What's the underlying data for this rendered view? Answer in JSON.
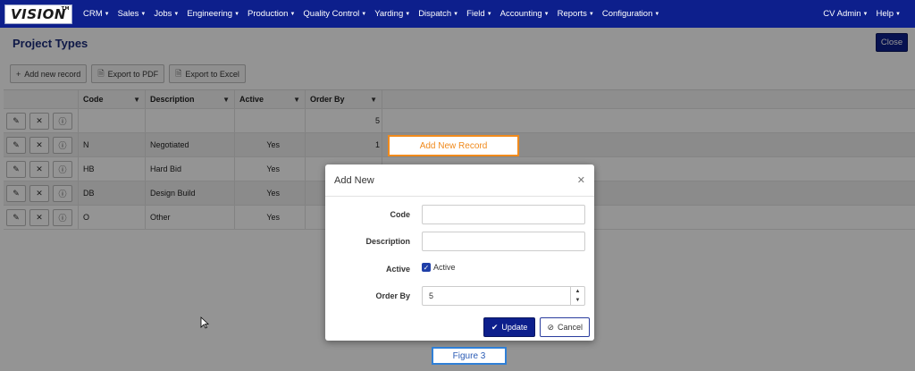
{
  "nav": {
    "logo": "VISION",
    "logo_tm": "TM",
    "menu": [
      {
        "label": "CRM"
      },
      {
        "label": "Sales"
      },
      {
        "label": "Jobs"
      },
      {
        "label": "Engineering"
      },
      {
        "label": "Production"
      },
      {
        "label": "Quality Control"
      },
      {
        "label": "Yarding"
      },
      {
        "label": "Dispatch"
      },
      {
        "label": "Field"
      },
      {
        "label": "Accounting"
      },
      {
        "label": "Reports"
      },
      {
        "label": "Configuration"
      }
    ],
    "user": "CV Admin",
    "help": "Help"
  },
  "page": {
    "title": "Project Types",
    "close_label": "Close",
    "toolbar": {
      "add": "Add new record",
      "pdf": "Export to PDF",
      "excel": "Export to Excel"
    }
  },
  "grid": {
    "columns": {
      "code": "Code",
      "description": "Description",
      "active": "Active",
      "order_by": "Order By"
    },
    "rows": [
      {
        "code": "",
        "description": "",
        "active": "",
        "order_by": "5"
      },
      {
        "code": "N",
        "description": "Negotiated",
        "active": "Yes",
        "order_by": "1"
      },
      {
        "code": "HB",
        "description": "Hard Bid",
        "active": "Yes",
        "order_by": ""
      },
      {
        "code": "DB",
        "description": "Design Build",
        "active": "Yes",
        "order_by": ""
      },
      {
        "code": "O",
        "description": "Other",
        "active": "Yes",
        "order_by": ""
      }
    ]
  },
  "annotations": {
    "callout": "Add New Record",
    "figure": "Figure 3"
  },
  "modal": {
    "title": "Add New",
    "fields": {
      "code_label": "Code",
      "code_value": "",
      "description_label": "Description",
      "description_value": "",
      "active_label": "Active",
      "active_checkbox_label": "Active",
      "active_checked": true,
      "order_label": "Order By",
      "order_value": "5"
    },
    "update_label": "Update",
    "cancel_label": "Cancel"
  },
  "colors": {
    "navbar": "#0d1f8c",
    "primary_button": "#0d1f8c",
    "callout_border": "#f08a1c",
    "figure_border": "#2f7fd6"
  }
}
